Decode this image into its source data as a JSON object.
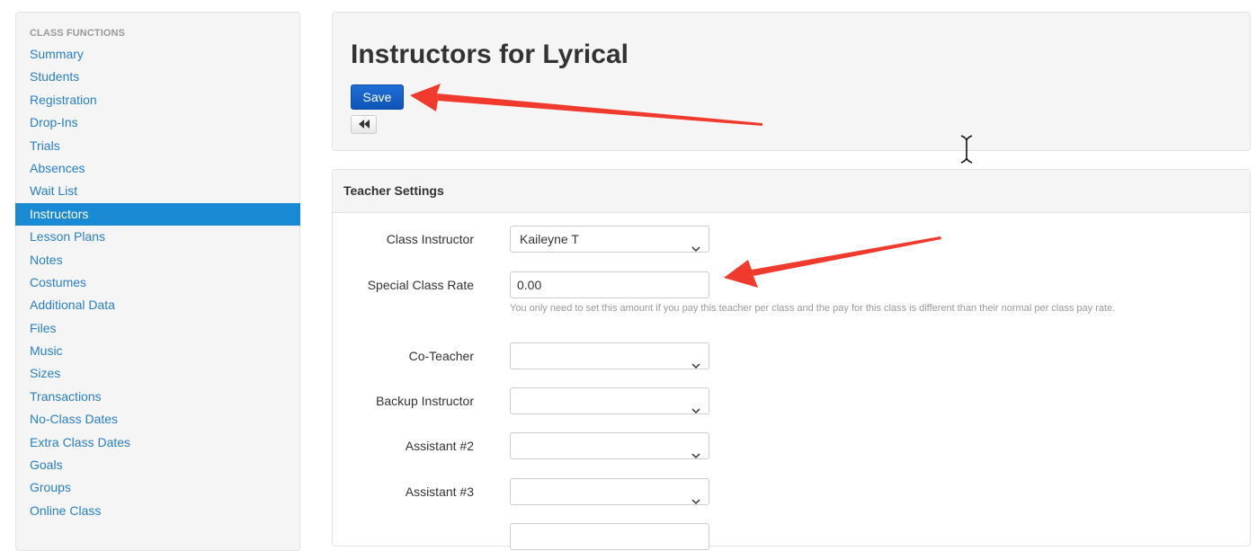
{
  "sidebar": {
    "header": "CLASS FUNCTIONS",
    "items": [
      {
        "label": "Summary"
      },
      {
        "label": "Students"
      },
      {
        "label": "Registration"
      },
      {
        "label": "Drop-Ins"
      },
      {
        "label": "Trials"
      },
      {
        "label": "Absences"
      },
      {
        "label": "Wait List"
      },
      {
        "label": "Instructors"
      },
      {
        "label": "Lesson Plans"
      },
      {
        "label": "Notes"
      },
      {
        "label": "Costumes"
      },
      {
        "label": "Additional Data"
      },
      {
        "label": "Files"
      },
      {
        "label": "Music"
      },
      {
        "label": "Sizes"
      },
      {
        "label": "Transactions"
      },
      {
        "label": "No-Class Dates"
      },
      {
        "label": "Extra Class Dates"
      },
      {
        "label": "Goals"
      },
      {
        "label": "Groups"
      },
      {
        "label": "Online Class"
      }
    ],
    "active_item": "Instructors"
  },
  "header": {
    "title": "Instructors for Lyrical",
    "save_label": "Save",
    "back_icon": "double-left-arrow-icon"
  },
  "settings": {
    "heading": "Teacher Settings",
    "class_instructor": {
      "label": "Class Instructor",
      "value": "Kaileyne T"
    },
    "special_class_rate": {
      "label": "Special Class Rate",
      "value": "0.00",
      "help": "You only need to set this amount if you pay this teacher per class and the pay for this class is different than their normal per class pay rate."
    },
    "co_teacher": {
      "label": "Co-Teacher",
      "value": ""
    },
    "backup_instructor": {
      "label": "Backup Instructor",
      "value": ""
    },
    "assistant_2": {
      "label": "Assistant #2",
      "value": ""
    },
    "assistant_3": {
      "label": "Assistant #3",
      "value": ""
    }
  },
  "colors": {
    "accent": "#1a8ad4",
    "link": "#2a7fc4",
    "save_button": "#0d54b8",
    "annotation_arrow": "#f03a2e"
  }
}
